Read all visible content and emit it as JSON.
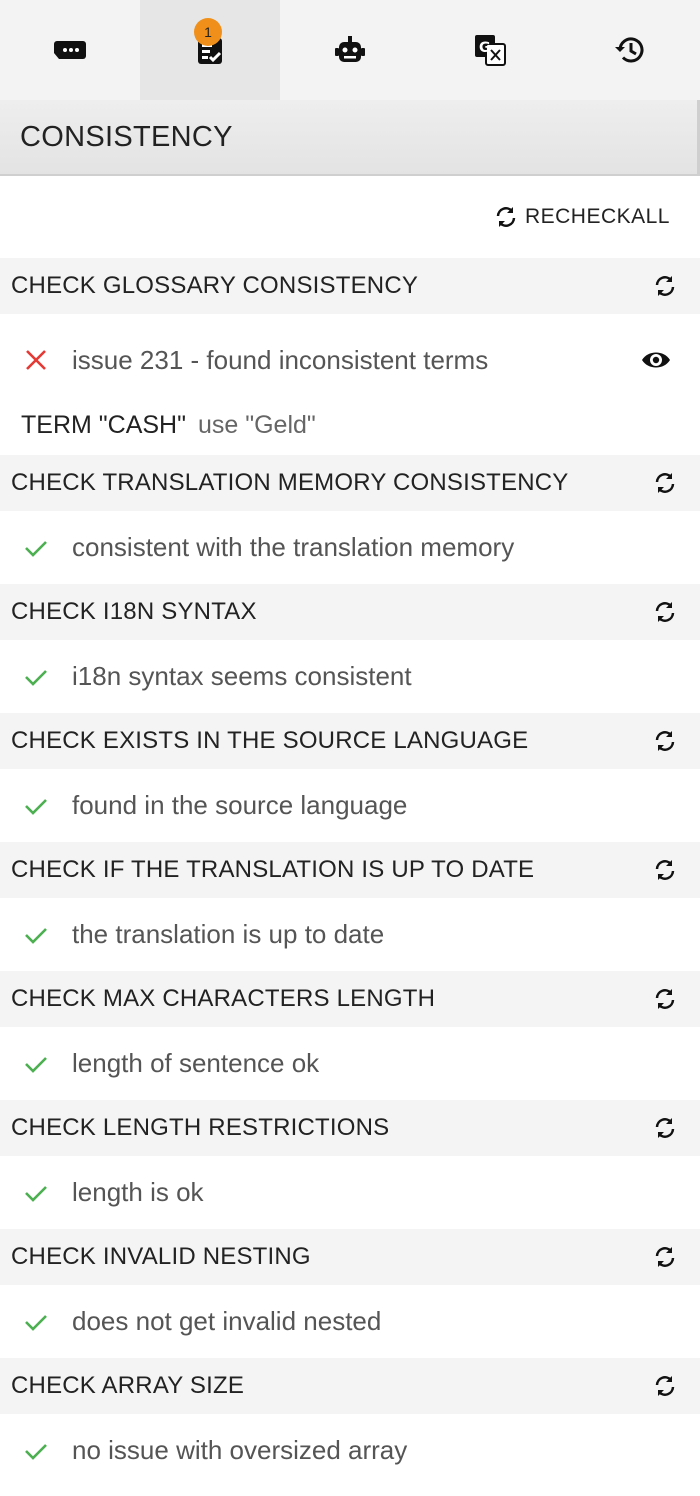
{
  "toolbar": {
    "buttons": [
      {
        "icon": "chat-dots-icon"
      },
      {
        "icon": "checklist-icon",
        "badge": "1",
        "active": true
      },
      {
        "icon": "robot-icon"
      },
      {
        "icon": "translate-icon"
      },
      {
        "icon": "history-icon"
      }
    ]
  },
  "section": {
    "title": "CONSISTENCY"
  },
  "recheck_all_label": "RECHECKALL",
  "checks": [
    {
      "title": "CHECK GLOSSARY CONSISTENCY",
      "status": "fail",
      "message": "issue 231 - found inconsistent terms",
      "term_label": "TERM \"CASH\"",
      "term_hint": "use \"Geld\""
    },
    {
      "title": "CHECK TRANSLATION MEMORY CONSISTENCY",
      "status": "ok",
      "message": "consistent with the translation memory"
    },
    {
      "title": "CHECK I18N SYNTAX",
      "status": "ok",
      "message": "i18n syntax seems consistent"
    },
    {
      "title": "CHECK EXISTS IN THE SOURCE LANGUAGE",
      "status": "ok",
      "message": "found in the source language"
    },
    {
      "title": "CHECK IF THE TRANSLATION IS UP TO DATE",
      "status": "ok",
      "message": "the translation is up to date"
    },
    {
      "title": "CHECK MAX CHARACTERS LENGTH",
      "status": "ok",
      "message": "length of sentence ok"
    },
    {
      "title": "CHECK LENGTH RESTRICTIONS",
      "status": "ok",
      "message": "length is ok"
    },
    {
      "title": "CHECK INVALID NESTING",
      "status": "ok",
      "message": "does not get invalid nested"
    },
    {
      "title": "CHECK ARRAY SIZE",
      "status": "ok",
      "message": "no issue with oversized array"
    }
  ],
  "colors": {
    "ok": "#4caf50",
    "fail": "#e53935",
    "badge": "#f0901a"
  }
}
